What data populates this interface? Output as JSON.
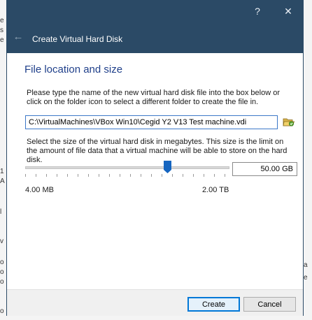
{
  "window": {
    "help_button": "?",
    "close_button": "✕"
  },
  "header": {
    "back_icon": "←",
    "title": "Create Virtual Hard Disk"
  },
  "main": {
    "section_title": "File location and size",
    "description_1": "Please type the name of the new virtual hard disk file into the box below or click on the folder icon to select a different folder to create the file in.",
    "file_path": "C:\\VirtualMachines\\VBox Win10\\Cegid Y2 V13 Test machine.vdi",
    "folder_icon": "folder-open-icon",
    "description_2": "Select the size of the virtual hard disk in megabytes. This size is the limit on the amount of file data that a virtual machine will be able to store on the hard disk.",
    "size_value": "50.00 GB",
    "slider_min_label": "4.00 MB",
    "slider_max_label": "2.00 TB"
  },
  "footer": {
    "create_label": "Create",
    "cancel_label": "Cancel"
  },
  "colors": {
    "title_bar": "#2b4a66",
    "section_title": "#1f3f8a",
    "slider_thumb": "#1565c0",
    "default_button_border": "#0078d7"
  }
}
